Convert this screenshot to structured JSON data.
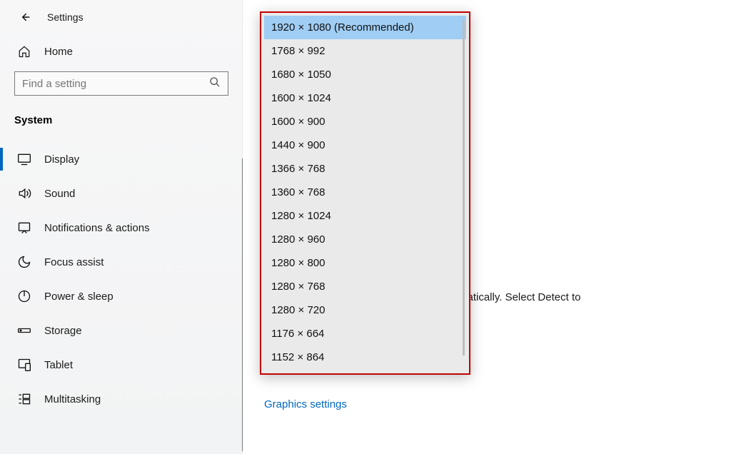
{
  "header": {
    "title": "Settings"
  },
  "home": {
    "label": "Home"
  },
  "search": {
    "placeholder": "Find a setting"
  },
  "section": {
    "label": "System"
  },
  "nav": {
    "items": [
      {
        "label": "Display",
        "icon": "display-icon",
        "active": true
      },
      {
        "label": "Sound",
        "icon": "sound-icon"
      },
      {
        "label": "Notifications & actions",
        "icon": "notifications-icon"
      },
      {
        "label": "Focus assist",
        "icon": "focus-icon"
      },
      {
        "label": "Power & sleep",
        "icon": "power-icon"
      },
      {
        "label": "Storage",
        "icon": "storage-icon"
      },
      {
        "label": "Tablet",
        "icon": "tablet-icon"
      },
      {
        "label": "Multitasking",
        "icon": "multitasking-icon"
      }
    ]
  },
  "resolution_dropdown": {
    "options": [
      "1920 × 1080 (Recommended)",
      "1768 × 992",
      "1680 × 1050",
      "1600 × 1024",
      "1600 × 900",
      "1440 × 900",
      "1366 × 768",
      "1360 × 768",
      "1280 × 1024",
      "1280 × 960",
      "1280 × 800",
      "1280 × 768",
      "1280 × 720",
      "1176 × 664",
      "1152 × 864"
    ],
    "selected_index": 0
  },
  "background": {
    "partial_text": "matically. Select Detect to"
  },
  "links": {
    "graphics": "Graphics settings"
  }
}
